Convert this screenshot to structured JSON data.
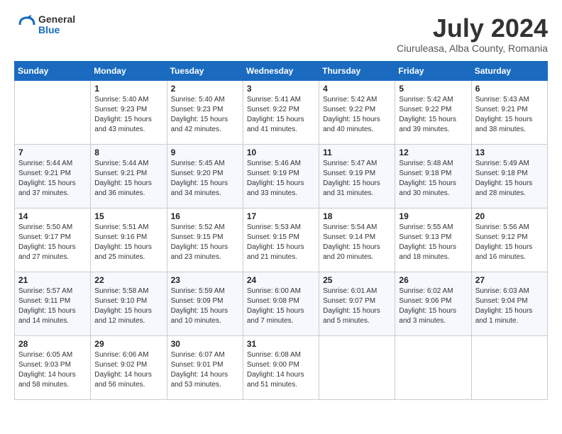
{
  "logo": {
    "general": "General",
    "blue": "Blue"
  },
  "title": {
    "month": "July 2024",
    "location": "Ciuruleasa, Alba County, Romania"
  },
  "headers": [
    "Sunday",
    "Monday",
    "Tuesday",
    "Wednesday",
    "Thursday",
    "Friday",
    "Saturday"
  ],
  "weeks": [
    [
      {
        "day": "",
        "info": ""
      },
      {
        "day": "1",
        "info": "Sunrise: 5:40 AM\nSunset: 9:23 PM\nDaylight: 15 hours\nand 43 minutes."
      },
      {
        "day": "2",
        "info": "Sunrise: 5:40 AM\nSunset: 9:23 PM\nDaylight: 15 hours\nand 42 minutes."
      },
      {
        "day": "3",
        "info": "Sunrise: 5:41 AM\nSunset: 9:22 PM\nDaylight: 15 hours\nand 41 minutes."
      },
      {
        "day": "4",
        "info": "Sunrise: 5:42 AM\nSunset: 9:22 PM\nDaylight: 15 hours\nand 40 minutes."
      },
      {
        "day": "5",
        "info": "Sunrise: 5:42 AM\nSunset: 9:22 PM\nDaylight: 15 hours\nand 39 minutes."
      },
      {
        "day": "6",
        "info": "Sunrise: 5:43 AM\nSunset: 9:21 PM\nDaylight: 15 hours\nand 38 minutes."
      }
    ],
    [
      {
        "day": "7",
        "info": "Sunrise: 5:44 AM\nSunset: 9:21 PM\nDaylight: 15 hours\nand 37 minutes."
      },
      {
        "day": "8",
        "info": "Sunrise: 5:44 AM\nSunset: 9:21 PM\nDaylight: 15 hours\nand 36 minutes."
      },
      {
        "day": "9",
        "info": "Sunrise: 5:45 AM\nSunset: 9:20 PM\nDaylight: 15 hours\nand 34 minutes."
      },
      {
        "day": "10",
        "info": "Sunrise: 5:46 AM\nSunset: 9:19 PM\nDaylight: 15 hours\nand 33 minutes."
      },
      {
        "day": "11",
        "info": "Sunrise: 5:47 AM\nSunset: 9:19 PM\nDaylight: 15 hours\nand 31 minutes."
      },
      {
        "day": "12",
        "info": "Sunrise: 5:48 AM\nSunset: 9:18 PM\nDaylight: 15 hours\nand 30 minutes."
      },
      {
        "day": "13",
        "info": "Sunrise: 5:49 AM\nSunset: 9:18 PM\nDaylight: 15 hours\nand 28 minutes."
      }
    ],
    [
      {
        "day": "14",
        "info": "Sunrise: 5:50 AM\nSunset: 9:17 PM\nDaylight: 15 hours\nand 27 minutes."
      },
      {
        "day": "15",
        "info": "Sunrise: 5:51 AM\nSunset: 9:16 PM\nDaylight: 15 hours\nand 25 minutes."
      },
      {
        "day": "16",
        "info": "Sunrise: 5:52 AM\nSunset: 9:15 PM\nDaylight: 15 hours\nand 23 minutes."
      },
      {
        "day": "17",
        "info": "Sunrise: 5:53 AM\nSunset: 9:15 PM\nDaylight: 15 hours\nand 21 minutes."
      },
      {
        "day": "18",
        "info": "Sunrise: 5:54 AM\nSunset: 9:14 PM\nDaylight: 15 hours\nand 20 minutes."
      },
      {
        "day": "19",
        "info": "Sunrise: 5:55 AM\nSunset: 9:13 PM\nDaylight: 15 hours\nand 18 minutes."
      },
      {
        "day": "20",
        "info": "Sunrise: 5:56 AM\nSunset: 9:12 PM\nDaylight: 15 hours\nand 16 minutes."
      }
    ],
    [
      {
        "day": "21",
        "info": "Sunrise: 5:57 AM\nSunset: 9:11 PM\nDaylight: 15 hours\nand 14 minutes."
      },
      {
        "day": "22",
        "info": "Sunrise: 5:58 AM\nSunset: 9:10 PM\nDaylight: 15 hours\nand 12 minutes."
      },
      {
        "day": "23",
        "info": "Sunrise: 5:59 AM\nSunset: 9:09 PM\nDaylight: 15 hours\nand 10 minutes."
      },
      {
        "day": "24",
        "info": "Sunrise: 6:00 AM\nSunset: 9:08 PM\nDaylight: 15 hours\nand 7 minutes."
      },
      {
        "day": "25",
        "info": "Sunrise: 6:01 AM\nSunset: 9:07 PM\nDaylight: 15 hours\nand 5 minutes."
      },
      {
        "day": "26",
        "info": "Sunrise: 6:02 AM\nSunset: 9:06 PM\nDaylight: 15 hours\nand 3 minutes."
      },
      {
        "day": "27",
        "info": "Sunrise: 6:03 AM\nSunset: 9:04 PM\nDaylight: 15 hours\nand 1 minute."
      }
    ],
    [
      {
        "day": "28",
        "info": "Sunrise: 6:05 AM\nSunset: 9:03 PM\nDaylight: 14 hours\nand 58 minutes."
      },
      {
        "day": "29",
        "info": "Sunrise: 6:06 AM\nSunset: 9:02 PM\nDaylight: 14 hours\nand 56 minutes."
      },
      {
        "day": "30",
        "info": "Sunrise: 6:07 AM\nSunset: 9:01 PM\nDaylight: 14 hours\nand 53 minutes."
      },
      {
        "day": "31",
        "info": "Sunrise: 6:08 AM\nSunset: 9:00 PM\nDaylight: 14 hours\nand 51 minutes."
      },
      {
        "day": "",
        "info": ""
      },
      {
        "day": "",
        "info": ""
      },
      {
        "day": "",
        "info": ""
      }
    ]
  ]
}
